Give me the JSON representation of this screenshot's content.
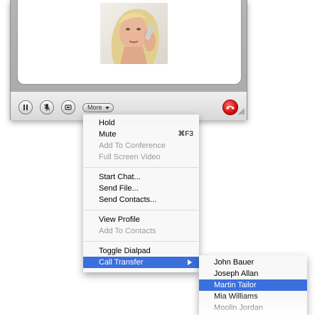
{
  "toolbar": {
    "pause_icon": "pause-icon",
    "mute_icon": "microphone-mute-icon",
    "video_icon": "video-camera-icon",
    "more_label": "More",
    "hangup_icon": "hangup-phone-icon",
    "hangup_color": "#d00000"
  },
  "context_menu": {
    "items": [
      {
        "label": "Hold",
        "enabled": true
      },
      {
        "label": "Mute",
        "shortcut": "⌘F3",
        "enabled": true
      },
      {
        "label": "Add To Conference",
        "enabled": false
      },
      {
        "label": "Full Screen Video",
        "enabled": false
      },
      {
        "label": "Start Chat...",
        "enabled": true
      },
      {
        "label": "Send File...",
        "enabled": true
      },
      {
        "label": "Send Contacts...",
        "enabled": true
      },
      {
        "label": "View Profile",
        "enabled": true
      },
      {
        "label": "Add To Contacts",
        "enabled": false
      },
      {
        "label": "Toggle Dialpad",
        "enabled": true
      },
      {
        "label": "Call Transfer",
        "enabled": true,
        "selected": true,
        "has_submenu": true
      }
    ]
  },
  "transfer_menu": {
    "contacts": [
      {
        "name": "John Bauer",
        "selected": false
      },
      {
        "name": "Joseph Allan",
        "selected": false
      },
      {
        "name": "Martin Tailor",
        "selected": true
      },
      {
        "name": "Mia Williams",
        "selected": false
      },
      {
        "name": "Moolin Jordan",
        "selected": false
      }
    ]
  },
  "colors": {
    "selection": "#3a6fdc",
    "disabled_text": "#9a9a9a"
  }
}
